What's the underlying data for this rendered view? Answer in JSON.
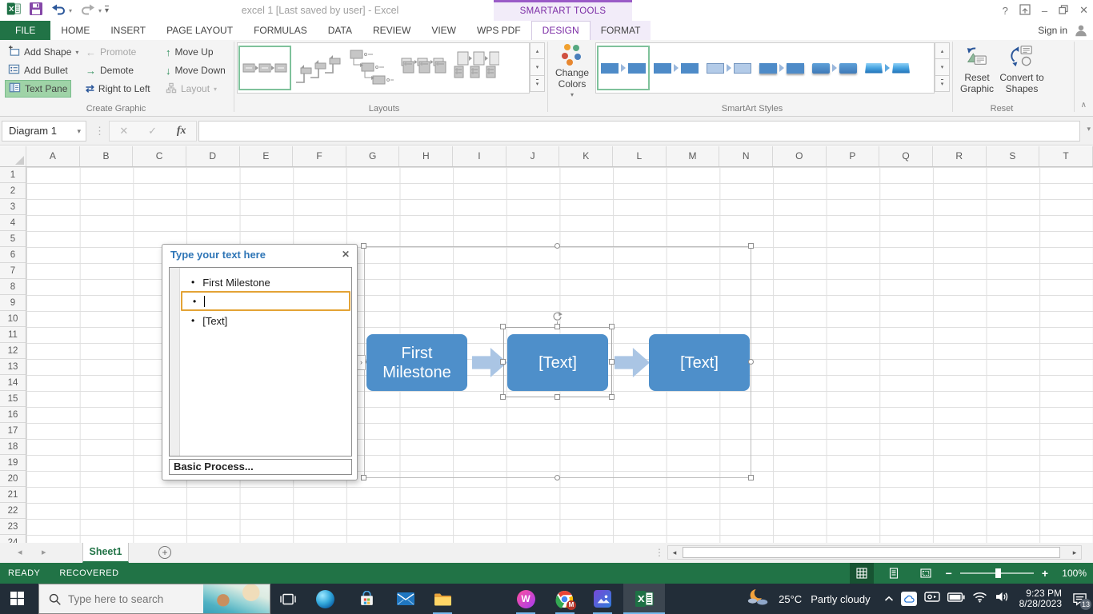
{
  "app": {
    "title": "excel 1 [Last saved by user] - Excel",
    "contextual_group": "SMARTART TOOLS",
    "sign_in": "Sign in"
  },
  "glyphs": {
    "dropdown": "▾",
    "scroll_up": "▴",
    "scroll_down": "▾",
    "nav_left": "◂",
    "nav_right": "▸",
    "close": "✕",
    "minimize": "–",
    "help": "?",
    "cancel": "✕",
    "enter": "✓",
    "grip": "⋮",
    "bullet": "•",
    "promote": "←",
    "demote": "→",
    "move_up": "↑",
    "move_down": "↓",
    "rtl": "⇄",
    "collapse": "∧",
    "add": "+",
    "zoom_minus": "−",
    "zoom_plus": "+",
    "pane_toggle": "›"
  },
  "tabs": [
    {
      "label": "FILE",
      "state": "file"
    },
    {
      "label": "HOME"
    },
    {
      "label": "INSERT"
    },
    {
      "label": "PAGE LAYOUT"
    },
    {
      "label": "FORMULAS"
    },
    {
      "label": "DATA"
    },
    {
      "label": "REVIEW"
    },
    {
      "label": "VIEW"
    },
    {
      "label": "WPS PDF"
    },
    {
      "label": "DESIGN",
      "state": "selected-contextual"
    },
    {
      "label": "FORMAT",
      "state": "contextual"
    }
  ],
  "ribbon": {
    "create_graphic": {
      "group_label": "Create Graphic",
      "add_shape": "Add Shape",
      "add_bullet": "Add Bullet",
      "text_pane": "Text Pane",
      "promote": "Promote",
      "demote": "Demote",
      "right_to_left": "Right to Left",
      "move_up": "Move Up",
      "move_down": "Move Down",
      "layout": "Layout"
    },
    "layouts": {
      "group_label": "Layouts",
      "gallery": [
        "basic-process",
        "step-up-process",
        "alternating-flow",
        "picture-accent-process",
        "vertical-picture-list"
      ],
      "selected_index": 0
    },
    "smartart_styles": {
      "group_label": "SmartArt Styles",
      "change_colors": "Change Colors",
      "gallery": [
        "simple-fill",
        "white-outline",
        "subtle-effect",
        "moderate-effect",
        "intense-effect",
        "polished-3d"
      ],
      "selected_index": 0
    },
    "reset": {
      "group_label": "Reset",
      "reset_graphic": "Reset Graphic",
      "convert_to_shapes": "Convert to Shapes"
    }
  },
  "formula_bar": {
    "name_box": "Diagram 1",
    "fx_label": "fx",
    "value": ""
  },
  "grid": {
    "columns": [
      "A",
      "B",
      "C",
      "D",
      "E",
      "F",
      "G",
      "H",
      "I",
      "J",
      "K",
      "L",
      "M",
      "N",
      "O",
      "P",
      "Q",
      "R",
      "S",
      "T"
    ],
    "rows": [
      "1",
      "2",
      "3",
      "4",
      "5",
      "6",
      "7",
      "8",
      "9",
      "10",
      "11",
      "12",
      "13",
      "14",
      "15",
      "16",
      "17",
      "18",
      "19",
      "20",
      "21",
      "22",
      "23",
      "24"
    ]
  },
  "text_pane": {
    "title": "Type your text here",
    "items": [
      {
        "text": "First Milestone"
      },
      {
        "text": "",
        "active": true
      },
      {
        "text": "[Text]"
      }
    ],
    "footer": "Basic Process..."
  },
  "smartart": {
    "shapes": [
      "First Milestone",
      "[Text]",
      "[Text]"
    ],
    "selected_index": 1
  },
  "sheet_bar": {
    "sheet_tabs": [
      "Sheet1"
    ],
    "active_index": 0
  },
  "status_bar": {
    "mode": "READY",
    "recovered": "RECOVERED",
    "zoom_level": "100%"
  },
  "taskbar": {
    "search_placeholder": "Type here to search",
    "weather": {
      "temp": "25°C",
      "condition": "Partly cloudy"
    },
    "clock": {
      "time": "9:23 PM",
      "date": "8/28/2023"
    },
    "notification_badge": "13"
  },
  "colors": {
    "excel_green": "#217346",
    "contextual_purple": "#9a5bc7",
    "shape_blue": "#4e8fca",
    "gallery_selection_green": "#7fc29b",
    "taskbar_bg": "#222d38"
  }
}
